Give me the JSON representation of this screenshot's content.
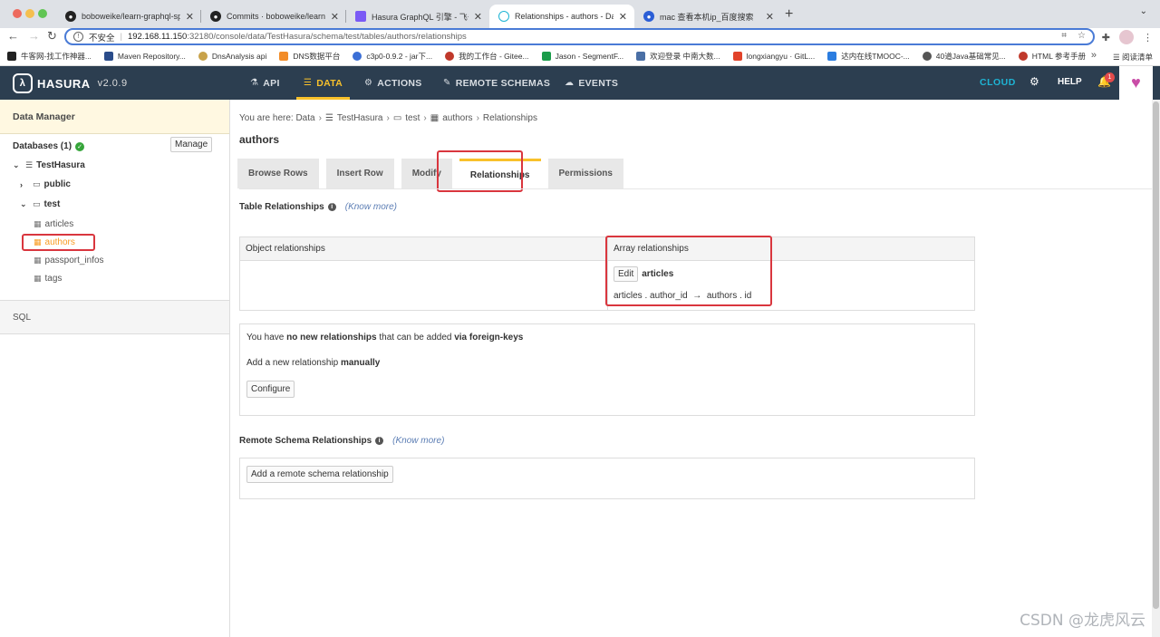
{
  "browser": {
    "tabs": [
      {
        "title": "boboweike/learn-graphql-sprin",
        "icon": "github-icon"
      },
      {
        "title": "Commits · boboweike/learn-gr",
        "icon": "github-icon"
      },
      {
        "title": "Hasura GraphQL 引擎 - 飞书云",
        "icon": "feishu-icon"
      },
      {
        "title": "Relationships - authors - Data",
        "icon": "hasura-icon"
      },
      {
        "title": "mac 查看本机ip_百度搜索",
        "icon": "baidu-icon"
      }
    ],
    "url_security": "不安全",
    "url_host": "192.168.11.150",
    "url_path": ":32180/console/data/TestHasura/schema/test/tables/authors/relationships",
    "bookmarks": [
      "牛客网-找工作神器...",
      "Maven Repository...",
      "DnsAnalysis api",
      "DNS数据平台",
      "c3p0-0.9.2 - jar下...",
      "我的工作台 - Gitee...",
      "Jason - SegmentF...",
      "欢迎登录 中南大数...",
      "longxiangyu · GitL...",
      "达内在线TMOOC-...",
      "40道Java基础常见...",
      "HTML 参考手册"
    ],
    "reading_list": "阅读清单"
  },
  "topnav": {
    "logo": "HASURA",
    "version": "v2.0.9",
    "items": [
      "API",
      "DATA",
      "ACTIONS",
      "REMOTE SCHEMAS",
      "EVENTS"
    ],
    "active": "DATA",
    "cloud": "CLOUD",
    "help": "HELP",
    "notifications": "1",
    "accent": "#f8c12b",
    "bg": "#2c3e50"
  },
  "sidebar": {
    "header": "Data Manager",
    "databases": "Databases (1)",
    "manage": "Manage",
    "db_name": "TestHasura",
    "schemas": [
      "public",
      "test"
    ],
    "tables": [
      "articles",
      "authors",
      "passport_infos",
      "tags"
    ],
    "selected": "authors",
    "sql": "SQL"
  },
  "main": {
    "breadcrumb": {
      "prefix": "You are here: Data",
      "db": "TestHasura",
      "schema": "test",
      "table": "authors",
      "page": "Relationships"
    },
    "title": "authors",
    "tabs": [
      "Browse Rows",
      "Insert Row",
      "Modify",
      "Relationships",
      "Permissions"
    ],
    "active_tab": "Relationships",
    "table_rel_title": "Table Relationships",
    "know_more": "(Know more)",
    "object_rel": "Object relationships",
    "array_rel": "Array relationships",
    "edit": "Edit",
    "rel_name": "articles",
    "rel_from": "articles . author_id",
    "rel_arrow": "→",
    "rel_to": "authors . id",
    "fk": {
      "p1": "You have ",
      "b1": "no new relationships",
      "p2": " that can be added ",
      "b2": "via foreign-keys",
      "p3": "Add a new relationship ",
      "b3": "manually",
      "configure": "Configure"
    },
    "remote_title": "Remote Schema Relationships",
    "remote_know": "(Know more)",
    "add_remote": "Add a remote schema relationship"
  },
  "watermark": "CSDN @龙虎风云"
}
